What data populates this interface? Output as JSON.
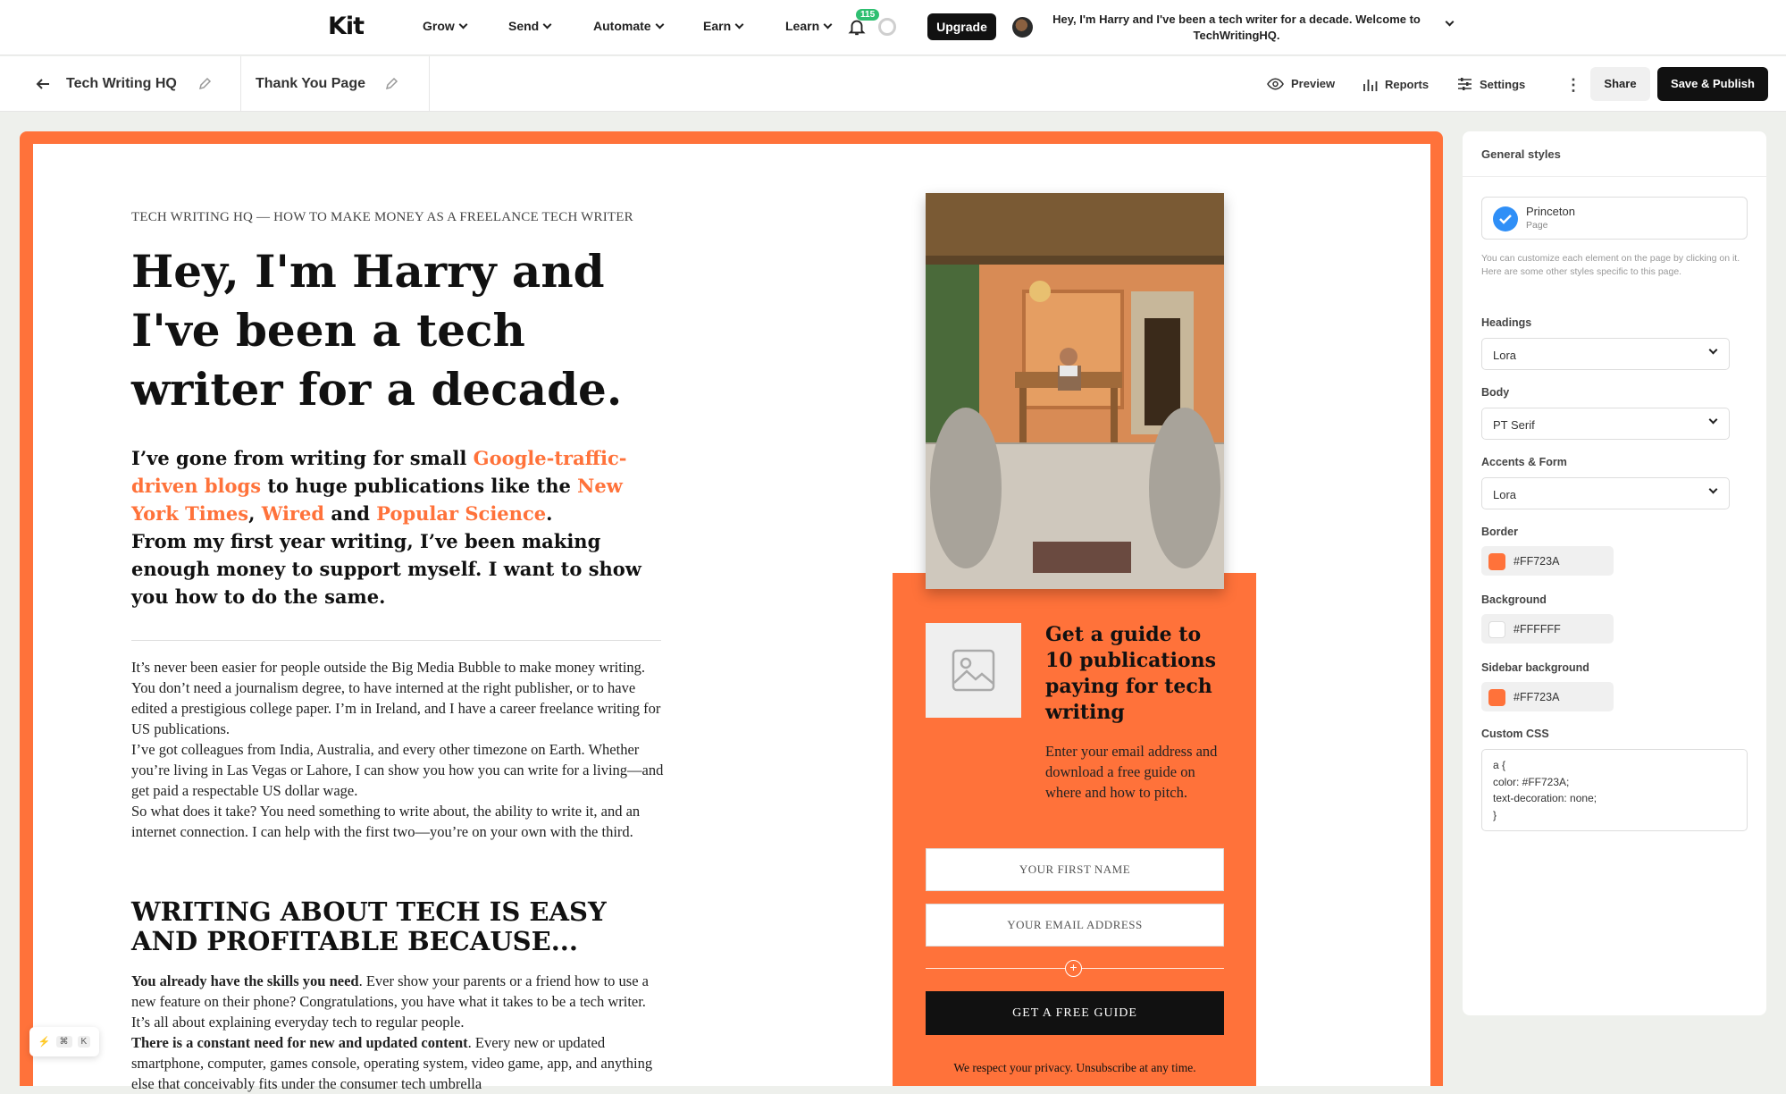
{
  "topnav": {
    "logo": "Kit",
    "items": [
      "Grow",
      "Send",
      "Automate",
      "Earn",
      "Learn"
    ],
    "notifications": "115",
    "upgrade": "Upgrade",
    "account_line1": "Hey, I'm Harry and I've been a tech writer for a decade. Welcome to",
    "account_line2": "TechWritingHQ."
  },
  "editbar": {
    "site": "Tech Writing HQ",
    "page": "Thank You Page",
    "preview": "Preview",
    "reports": "Reports",
    "settings": "Settings",
    "share": "Share",
    "publish": "Save & Publish"
  },
  "page": {
    "kicker": "TECH WRITING HQ — HOW TO MAKE MONEY AS A FREELANCE TECH WRITER",
    "hero": "Hey, I'm Harry and I've been a tech writer for a decade.",
    "lede": {
      "p1_a": "I’ve gone from writing for small ",
      "link1": "Google-traffic-driven blogs",
      "p1_b": " to huge publications like the ",
      "link2": "New York Times",
      "comma": ",",
      "link3": "Wired",
      "and": " and ",
      "link4": "Popular Science",
      "dot": ".",
      "p2": "From my first year writing, I’ve been making enough money to support myself. I want to show you how to do the same."
    },
    "body": [
      "It’s never been easier for people outside the Big Media Bubble to make money writing. You don’t need a journalism degree, to have interned at the right publisher, or to have edited a prestigious college paper. I’m in Ireland, and I have a career freelance writing for US publications.",
      "I’ve got colleagues from India, Australia, and every other timezone on Earth. Whether you’re living in Las Vegas or Lahore, I can show you how you can write for a living—and get paid a respectable US dollar wage.",
      "So what does it take? You need something to write about, the ability to write it, and an internet connection. I can help with the first two—you’re on your own with the third."
    ],
    "h2": "WRITING ABOUT TECH IS EASY AND PROFITABLE BECAUSE...",
    "body2": {
      "b1": "You already have the skills you need",
      "t1": ". Ever show your parents or a friend how to use a new feature on their phone? Congratulations, you have what it takes to be a tech writer. It’s all about explaining everyday tech to regular people.",
      "b2": "There is a constant need for new and updated content",
      "t2": ". Every new or updated smartphone, computer, games console, operating system, video game, app, and anything else that conceivably fits under the consumer tech umbrella"
    },
    "form": {
      "title": "Get a guide to 10 publications paying for tech writing",
      "desc": "Enter your email address and download a free guide on where and how to pitch.",
      "first_name": "YOUR FIRST NAME",
      "email": "YOUR EMAIL ADDRESS",
      "cta": "GET A FREE GUIDE",
      "privacy": "We respect your privacy. Unsubscribe at any time."
    }
  },
  "panel": {
    "title": "General styles",
    "theme": "Princeton",
    "theme_sub": "Page",
    "hint": "You can customize each element on the page by clicking on it. Here are some other styles specific to this page.",
    "headings_label": "Headings",
    "headings": "Lora",
    "body_label": "Body",
    "body": "PT Serif",
    "accents_label": "Accents & Form",
    "accents": "Lora",
    "border_label": "Border",
    "border": "#FF723A",
    "background_label": "Background",
    "background": "#FFFFFF",
    "sidebar_label": "Sidebar background",
    "sidebar": "#FF723A",
    "css_label": "Custom CSS",
    "css": "a {\ncolor: #FF723A;\ntext-decoration: none;\n}"
  },
  "shortcut": [
    "⌘",
    "K"
  ]
}
